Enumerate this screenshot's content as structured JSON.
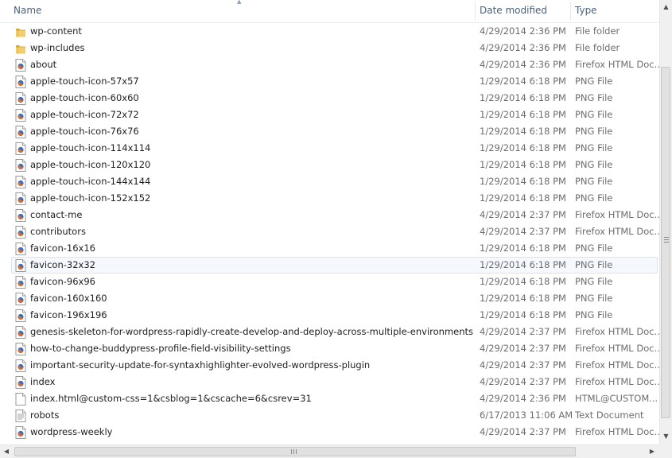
{
  "columns": {
    "name": "Name",
    "date": "Date modified",
    "type": "Type"
  },
  "files": [
    {
      "name": "wp-content",
      "date": "4/29/2014 2:36 PM",
      "type": "File folder",
      "icon": "folder"
    },
    {
      "name": "wp-includes",
      "date": "4/29/2014 2:36 PM",
      "type": "File folder",
      "icon": "folder"
    },
    {
      "name": "about",
      "date": "4/29/2014 2:36 PM",
      "type": "Firefox HTML Doc...",
      "icon": "firefox-doc"
    },
    {
      "name": "apple-touch-icon-57x57",
      "date": "1/29/2014 6:18 PM",
      "type": "PNG File",
      "icon": "firefox-doc"
    },
    {
      "name": "apple-touch-icon-60x60",
      "date": "1/29/2014 6:18 PM",
      "type": "PNG File",
      "icon": "firefox-doc"
    },
    {
      "name": "apple-touch-icon-72x72",
      "date": "1/29/2014 6:18 PM",
      "type": "PNG File",
      "icon": "firefox-doc"
    },
    {
      "name": "apple-touch-icon-76x76",
      "date": "1/29/2014 6:18 PM",
      "type": "PNG File",
      "icon": "firefox-doc"
    },
    {
      "name": "apple-touch-icon-114x114",
      "date": "1/29/2014 6:18 PM",
      "type": "PNG File",
      "icon": "firefox-doc"
    },
    {
      "name": "apple-touch-icon-120x120",
      "date": "1/29/2014 6:18 PM",
      "type": "PNG File",
      "icon": "firefox-doc"
    },
    {
      "name": "apple-touch-icon-144x144",
      "date": "1/29/2014 6:18 PM",
      "type": "PNG File",
      "icon": "firefox-doc"
    },
    {
      "name": "apple-touch-icon-152x152",
      "date": "1/29/2014 6:18 PM",
      "type": "PNG File",
      "icon": "firefox-doc"
    },
    {
      "name": "contact-me",
      "date": "4/29/2014 2:37 PM",
      "type": "Firefox HTML Doc...",
      "icon": "firefox-doc"
    },
    {
      "name": "contributors",
      "date": "4/29/2014 2:37 PM",
      "type": "Firefox HTML Doc...",
      "icon": "firefox-doc"
    },
    {
      "name": "favicon-16x16",
      "date": "1/29/2014 6:18 PM",
      "type": "PNG File",
      "icon": "firefox-doc"
    },
    {
      "name": "favicon-32x32",
      "date": "1/29/2014 6:18 PM",
      "type": "PNG File",
      "icon": "firefox-doc",
      "selected": true
    },
    {
      "name": "favicon-96x96",
      "date": "1/29/2014 6:18 PM",
      "type": "PNG File",
      "icon": "firefox-doc"
    },
    {
      "name": "favicon-160x160",
      "date": "1/29/2014 6:18 PM",
      "type": "PNG File",
      "icon": "firefox-doc"
    },
    {
      "name": "favicon-196x196",
      "date": "1/29/2014 6:18 PM",
      "type": "PNG File",
      "icon": "firefox-doc"
    },
    {
      "name": "genesis-skeleton-for-wordpress-rapidly-create-develop-and-deploy-across-multiple-environments",
      "date": "4/29/2014 2:37 PM",
      "type": "Firefox HTML Doc...",
      "icon": "firefox-doc"
    },
    {
      "name": "how-to-change-buddypress-profile-field-visibility-settings",
      "date": "4/29/2014 2:37 PM",
      "type": "Firefox HTML Doc...",
      "icon": "firefox-doc"
    },
    {
      "name": "important-security-update-for-syntaxhighlighter-evolved-wordpress-plugin",
      "date": "4/29/2014 2:37 PM",
      "type": "Firefox HTML Doc...",
      "icon": "firefox-doc"
    },
    {
      "name": "index",
      "date": "4/29/2014 2:37 PM",
      "type": "Firefox HTML Doc...",
      "icon": "firefox-doc"
    },
    {
      "name": "index.html@custom-css=1&csblog=1&cscache=6&csrev=31",
      "date": "4/29/2014 2:36 PM",
      "type": "HTML@CUSTOM...",
      "icon": "generic-doc"
    },
    {
      "name": "robots",
      "date": "6/17/2013 11:06 AM",
      "type": "Text Document",
      "icon": "text-doc"
    },
    {
      "name": "wordpress-weekly",
      "date": "4/29/2014 2:37 PM",
      "type": "Firefox HTML Doc...",
      "icon": "firefox-doc"
    }
  ],
  "scrollbar": {
    "up": "▲",
    "down": "▼",
    "left": "◀",
    "right": "▶"
  },
  "colors": {
    "folder": "#e9c564",
    "selection": "#f5f8fc",
    "header_text": "#4c607a"
  }
}
